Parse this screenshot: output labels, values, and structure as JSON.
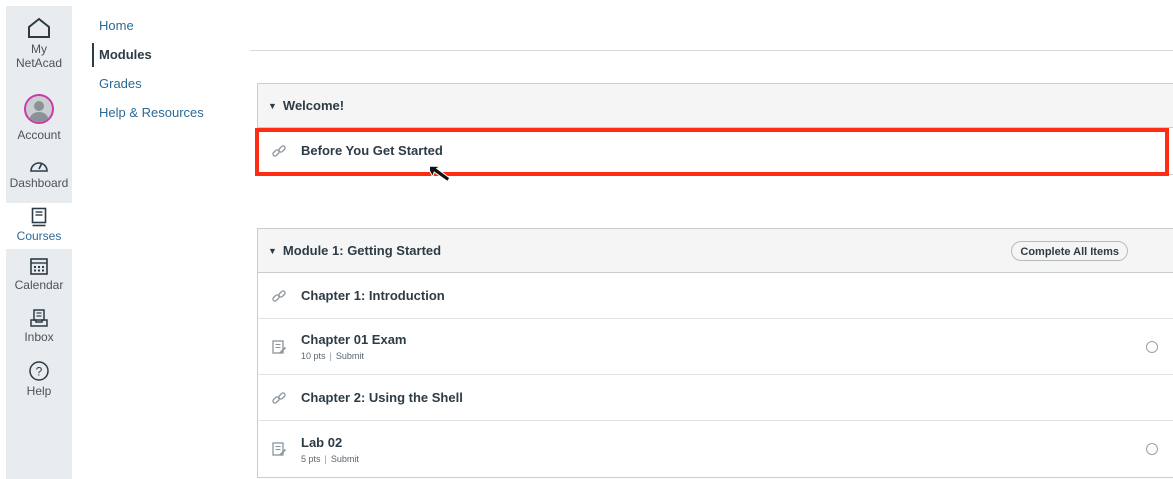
{
  "global_nav": {
    "items": [
      {
        "label_line1": "My",
        "label_line2": "NetAcad",
        "icon": "house-icon"
      },
      {
        "label": "Account",
        "icon": "avatar"
      },
      {
        "label": "Dashboard",
        "icon": "dashboard-gauge-icon"
      },
      {
        "label": "Courses",
        "icon": "book-icon",
        "active": true
      },
      {
        "label": "Calendar",
        "icon": "calendar-icon"
      },
      {
        "label": "Inbox",
        "icon": "inbox-icon"
      },
      {
        "label": "Help",
        "icon": "help-icon"
      }
    ]
  },
  "course_nav": {
    "items": [
      {
        "label": "Home"
      },
      {
        "label": "Modules",
        "active": true
      },
      {
        "label": "Grades"
      },
      {
        "label": "Help & Resources"
      }
    ]
  },
  "modules": [
    {
      "title": "Welcome!",
      "items": [
        {
          "title": "Before You Get Started",
          "icon": "link-icon"
        }
      ]
    },
    {
      "title": "Module 1: Getting Started",
      "complete_all_label": "Complete All Items",
      "items": [
        {
          "title": "Chapter 1: Introduction",
          "icon": "link-icon"
        },
        {
          "title": "Chapter 01 Exam",
          "icon": "quiz-icon",
          "points": "10 pts",
          "action": "Submit"
        },
        {
          "title": "Chapter 2: Using the Shell",
          "icon": "link-icon"
        },
        {
          "title": "Lab 02",
          "icon": "quiz-icon",
          "points": "5 pts",
          "action": "Submit"
        }
      ]
    }
  ],
  "colors": {
    "highlight": "#ff2b12",
    "link": "#2b6a98",
    "rail_bg": "#e9ecef",
    "avatar_ring": "#c73ca7"
  }
}
